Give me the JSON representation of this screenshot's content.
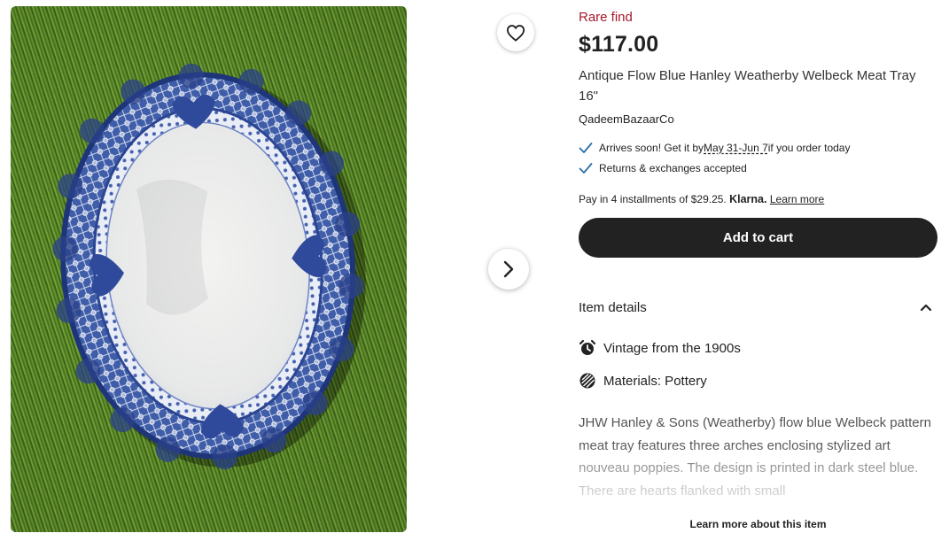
{
  "gallery": {
    "favorite_icon": "heart-outline-icon",
    "next_icon": "chevron-right-icon"
  },
  "listing": {
    "badge": "Rare find",
    "price": "$117.00",
    "title": "Antique Flow Blue Hanley Weatherby Welbeck Meat Tray 16\"",
    "shop_name": "QadeemBazaarCo",
    "delivery": {
      "prefix": "Arrives soon! Get it by ",
      "dates": "May 31-Jun 7",
      "suffix": " if you order today"
    },
    "returns": "Returns & exchanges accepted",
    "installments": {
      "text": "Pay in 4 installments of $29.25.",
      "provider": "Klarna.",
      "link": "Learn more"
    },
    "add_to_cart": "Add to cart"
  },
  "item_details": {
    "heading": "Item details",
    "attributes": [
      {
        "icon": "alarm-clock-icon",
        "label": "Vintage from the 1900s"
      },
      {
        "icon": "materials-icon",
        "label": "Materials: Pottery"
      }
    ],
    "description": "JHW Hanley & Sons (Weatherby) flow blue Welbeck pattern meat tray features three arches enclosing stylized art nouveau poppies. The design is printed in dark steel blue. There are hearts flanked with small",
    "learn_more": "Learn more about this item"
  },
  "colors": {
    "badge": "#a61a2e",
    "check": "#2a6fa8",
    "button": "#222222"
  }
}
